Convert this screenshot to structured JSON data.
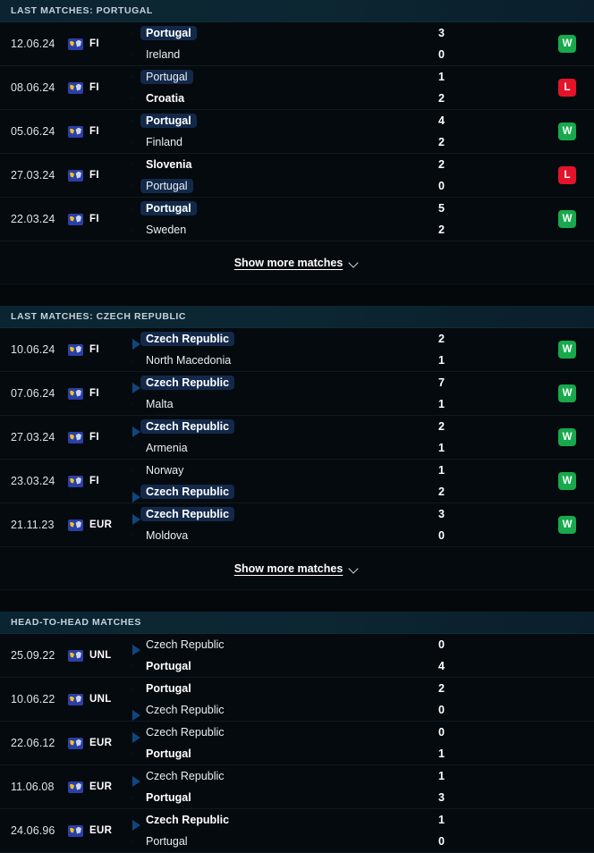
{
  "colors": {
    "win": "#17a94c",
    "loss": "#e3142a",
    "header_bg": "#0c2733",
    "highlight_bg": "#13294a",
    "row_bg": "#050a0e"
  },
  "show_more_label": "Show more matches",
  "sections": [
    {
      "id": "last-matches-portugal",
      "title": "LAST MATCHES: PORTUGAL",
      "has_show_more": true,
      "matches": [
        {
          "date": "12.06.24",
          "competition": "FI",
          "competition_icon": "uefa-friendly-icon",
          "home": {
            "team": "Portugal",
            "flag": "portugal",
            "bold": true,
            "highlight": true
          },
          "away": {
            "team": "Ireland",
            "flag": "ireland",
            "bold": false,
            "highlight": false
          },
          "home_score": "3",
          "away_score": "0",
          "result": "W"
        },
        {
          "date": "08.06.24",
          "competition": "FI",
          "competition_icon": "uefa-friendly-icon",
          "home": {
            "team": "Portugal",
            "flag": "portugal",
            "bold": false,
            "highlight": true
          },
          "away": {
            "team": "Croatia",
            "flag": "croatia",
            "bold": true,
            "highlight": false
          },
          "home_score": "1",
          "away_score": "2",
          "result": "L"
        },
        {
          "date": "05.06.24",
          "competition": "FI",
          "competition_icon": "uefa-friendly-icon",
          "home": {
            "team": "Portugal",
            "flag": "portugal",
            "bold": true,
            "highlight": true
          },
          "away": {
            "team": "Finland",
            "flag": "finland",
            "bold": false,
            "highlight": false
          },
          "home_score": "4",
          "away_score": "2",
          "result": "W"
        },
        {
          "date": "27.03.24",
          "competition": "FI",
          "competition_icon": "uefa-friendly-icon",
          "home": {
            "team": "Slovenia",
            "flag": "slovenia",
            "bold": true,
            "highlight": false
          },
          "away": {
            "team": "Portugal",
            "flag": "portugal",
            "bold": false,
            "highlight": true
          },
          "home_score": "2",
          "away_score": "0",
          "result": "L"
        },
        {
          "date": "22.03.24",
          "competition": "FI",
          "competition_icon": "uefa-friendly-icon",
          "home": {
            "team": "Portugal",
            "flag": "portugal",
            "bold": true,
            "highlight": true
          },
          "away": {
            "team": "Sweden",
            "flag": "sweden",
            "bold": false,
            "highlight": false
          },
          "home_score": "5",
          "away_score": "2",
          "result": "W"
        }
      ]
    },
    {
      "id": "last-matches-czech-republic",
      "title": "LAST MATCHES: CZECH REPUBLIC",
      "has_show_more": true,
      "matches": [
        {
          "date": "10.06.24",
          "competition": "FI",
          "competition_icon": "uefa-friendly-icon",
          "home": {
            "team": "Czech Republic",
            "flag": "czech",
            "bold": true,
            "highlight": true
          },
          "away": {
            "team": "North Macedonia",
            "flag": "nmacedonia",
            "bold": false,
            "highlight": false
          },
          "home_score": "2",
          "away_score": "1",
          "result": "W"
        },
        {
          "date": "07.06.24",
          "competition": "FI",
          "competition_icon": "uefa-friendly-icon",
          "home": {
            "team": "Czech Republic",
            "flag": "czech",
            "bold": true,
            "highlight": true
          },
          "away": {
            "team": "Malta",
            "flag": "malta",
            "bold": false,
            "highlight": false
          },
          "home_score": "7",
          "away_score": "1",
          "result": "W"
        },
        {
          "date": "27.03.24",
          "competition": "FI",
          "competition_icon": "uefa-friendly-icon",
          "home": {
            "team": "Czech Republic",
            "flag": "czech",
            "bold": true,
            "highlight": true
          },
          "away": {
            "team": "Armenia",
            "flag": "armenia",
            "bold": false,
            "highlight": false
          },
          "home_score": "2",
          "away_score": "1",
          "result": "W"
        },
        {
          "date": "23.03.24",
          "competition": "FI",
          "competition_icon": "uefa-friendly-icon",
          "home": {
            "team": "Norway",
            "flag": "norway",
            "bold": false,
            "highlight": false
          },
          "away": {
            "team": "Czech Republic",
            "flag": "czech",
            "bold": true,
            "highlight": true
          },
          "home_score": "1",
          "away_score": "2",
          "result": "W"
        },
        {
          "date": "21.11.23",
          "competition": "EUR",
          "competition_icon": "uefa-euro-icon",
          "home": {
            "team": "Czech Republic",
            "flag": "czech",
            "bold": true,
            "highlight": true
          },
          "away": {
            "team": "Moldova",
            "flag": "moldova",
            "bold": false,
            "highlight": false
          },
          "home_score": "3",
          "away_score": "0",
          "result": "W"
        }
      ]
    },
    {
      "id": "head-to-head-matches",
      "title": "HEAD-TO-HEAD MATCHES",
      "has_show_more": false,
      "matches": [
        {
          "date": "25.09.22",
          "competition": "UNL",
          "competition_icon": "uefa-nations-league-icon",
          "home": {
            "team": "Czech Republic",
            "flag": "czech",
            "bold": false,
            "highlight": false
          },
          "away": {
            "team": "Portugal",
            "flag": "portugal",
            "bold": true,
            "highlight": false
          },
          "home_score": "0",
          "away_score": "4",
          "result": ""
        },
        {
          "date": "10.06.22",
          "competition": "UNL",
          "competition_icon": "uefa-nations-league-icon",
          "home": {
            "team": "Portugal",
            "flag": "portugal",
            "bold": true,
            "highlight": false
          },
          "away": {
            "team": "Czech Republic",
            "flag": "czech",
            "bold": false,
            "highlight": false
          },
          "home_score": "2",
          "away_score": "0",
          "result": ""
        },
        {
          "date": "22.06.12",
          "competition": "EUR",
          "competition_icon": "uefa-euro-icon",
          "home": {
            "team": "Czech Republic",
            "flag": "czech",
            "bold": false,
            "highlight": false
          },
          "away": {
            "team": "Portugal",
            "flag": "portugal",
            "bold": true,
            "highlight": false
          },
          "home_score": "0",
          "away_score": "1",
          "result": ""
        },
        {
          "date": "11.06.08",
          "competition": "EUR",
          "competition_icon": "uefa-euro-icon",
          "home": {
            "team": "Czech Republic",
            "flag": "czech",
            "bold": false,
            "highlight": false
          },
          "away": {
            "team": "Portugal",
            "flag": "portugal",
            "bold": true,
            "highlight": false
          },
          "home_score": "1",
          "away_score": "3",
          "result": ""
        },
        {
          "date": "24.06.96",
          "competition": "EUR",
          "competition_icon": "uefa-euro-icon",
          "home": {
            "team": "Czech Republic",
            "flag": "czech",
            "bold": true,
            "highlight": false
          },
          "away": {
            "team": "Portugal",
            "flag": "portugal",
            "bold": false,
            "highlight": false
          },
          "home_score": "1",
          "away_score": "0",
          "result": ""
        }
      ]
    }
  ]
}
